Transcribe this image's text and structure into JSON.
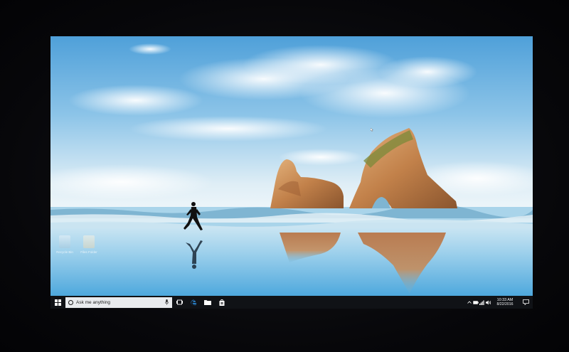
{
  "desktop": {
    "icons": [
      {
        "label": "Recycle Bin",
        "icon": "recycle-bin-icon"
      },
      {
        "label": "Files Folder",
        "icon": "folder-icon"
      }
    ]
  },
  "taskbar": {
    "search_placeholder": "Ask me anything",
    "pinned": [
      {
        "name": "task-view",
        "icon": "task-view-icon"
      },
      {
        "name": "edge",
        "icon": "edge-icon"
      },
      {
        "name": "file-explorer",
        "icon": "folder-icon"
      },
      {
        "name": "store",
        "icon": "store-icon"
      }
    ],
    "tray": [
      "chevron-up-icon",
      "battery-icon",
      "network-icon",
      "volume-icon"
    ],
    "clock": {
      "time": "10:33 AM",
      "date": "8/22/2016"
    }
  },
  "colors": {
    "taskbar": "#101216",
    "search_box": "#e9ebee",
    "sky_top": "#57a6dc",
    "sea": "#7fc4e6"
  }
}
